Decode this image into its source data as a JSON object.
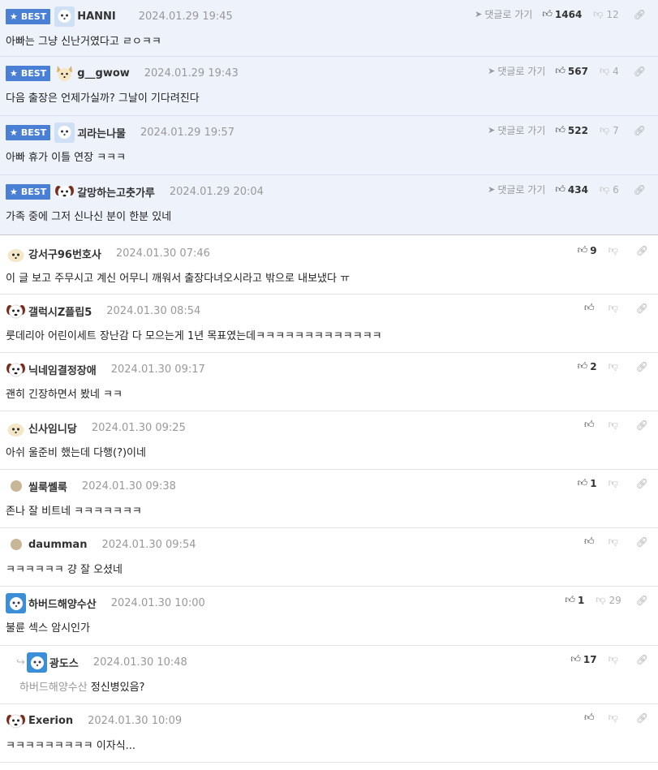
{
  "best_label": "BEST",
  "goto_label": "댓글로 가기",
  "comments": [
    {
      "nick": "HANNI",
      "date": "2024.01.29 19:45",
      "text": "아빠는 그냥 신난거였다고 ㄹㅇㅋㅋ",
      "up": "1464",
      "down": "12"
    },
    {
      "nick": "g__gwow",
      "date": "2024.01.29 19:43",
      "text": "다음 출장은 언제가실까? 그날이 기다려진다",
      "up": "567",
      "down": "4"
    },
    {
      "nick": "괴라는나물",
      "date": "2024.01.29 19:57",
      "text": "아빠 휴가 이틀 연장 ㅋㅋㅋ",
      "up": "522",
      "down": "7"
    },
    {
      "nick": "갈망하는고춧가루",
      "date": "2024.01.29 20:04",
      "text": "가족 중에 그저 신나신 분이 한분 있네",
      "up": "434",
      "down": "6"
    },
    {
      "nick": "강서구96번호사",
      "date": "2024.01.30 07:46",
      "text": "이 글 보고 주무시고 계신 어무니 깨워서 출장다녀오시라고 밖으로 내보냈다 ㅠ",
      "up": "9",
      "down": ""
    },
    {
      "nick": "갤럭시Z플립5",
      "date": "2024.01.30 08:54",
      "text": "룻데리아 어린이세트 장난감 다 모으는게 1년 목표였는데ㅋㅋㅋㅋㅋㅋㅋㅋㅋㅋㅋㅋㅋ",
      "up": "",
      "down": ""
    },
    {
      "nick": "닉네임결정장애",
      "date": "2024.01.30 09:17",
      "text": "괜히 긴장하면서 봤네 ㅋㅋ",
      "up": "2",
      "down": ""
    },
    {
      "nick": "신사임니당",
      "date": "2024.01.30 09:25",
      "text": "아쉬 울준비 했는데 다행(?)이네",
      "up": "",
      "down": ""
    },
    {
      "nick": "씰룩쎌룩",
      "date": "2024.01.30 09:38",
      "text": "존나 잘 비트네 ㅋㅋㅋㅋㅋㅋㅋ",
      "up": "1",
      "down": ""
    },
    {
      "nick": "daumman",
      "date": "2024.01.30 09:54",
      "text": "ㅋㅋㅋㅋㅋㅋ 걍 잘 오셨네",
      "up": "",
      "down": ""
    },
    {
      "nick": "하버드해양수산",
      "date": "2024.01.30 10:00",
      "text": "불륜 섹스 암시인가",
      "up": "1",
      "down": "29"
    },
    {
      "nick": "광도스",
      "date": "2024.01.30 10:48",
      "mention": "하버드해양수산",
      "text": "정신병있음?",
      "up": "17",
      "down": ""
    },
    {
      "nick": "Exerion",
      "date": "2024.01.30 10:09",
      "text": "ㅋㅋㅋㅋㅋㅋㅋㅋㅋ 이자식...",
      "up": "",
      "down": ""
    }
  ]
}
